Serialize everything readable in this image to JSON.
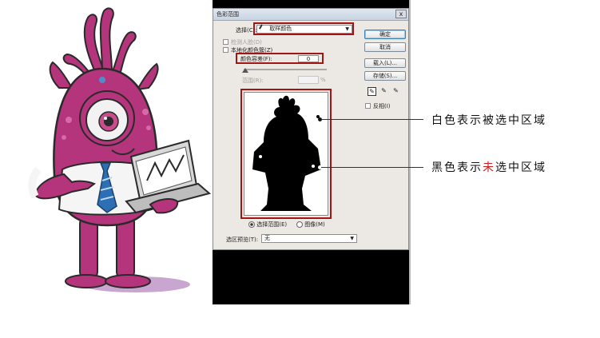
{
  "dialog": {
    "title": "色彩范围",
    "close_glyph": "x",
    "select_label": "选择(C):",
    "select_value": "取样颜色",
    "detect_faces_label": "检测人脸(D)",
    "localized_clusters_label": "本地化颜色簇(Z)",
    "fuzziness_label": "颜色容差(F):",
    "fuzziness_value": "0",
    "range_label": "范围(R):",
    "range_unit": "%",
    "ok_label": "确定",
    "cancel_label": "取消",
    "load_label": "载入(L)...",
    "save_label": "存储(S)...",
    "invert_label": "反相(I)",
    "radio_selection_label": "选择范围(E)",
    "radio_image_label": "图像(M)",
    "preview_label": "选区预览(T):",
    "preview_value": "无"
  },
  "annotations": {
    "white_note": "白色表示被选中区域",
    "black_note_prefix": "黑色表示",
    "black_note_highlight": "未",
    "black_note_suffix": "选中区域"
  },
  "colors": {
    "highlight_red": "#a31515",
    "annotation_red": "#c81e1e",
    "monster_pink": "#b4357c"
  },
  "icons": [
    "eyedropper-icon",
    "eyedropper-plus-icon",
    "eyedropper-minus-icon",
    "close-icon",
    "chevron-down-icon"
  ]
}
